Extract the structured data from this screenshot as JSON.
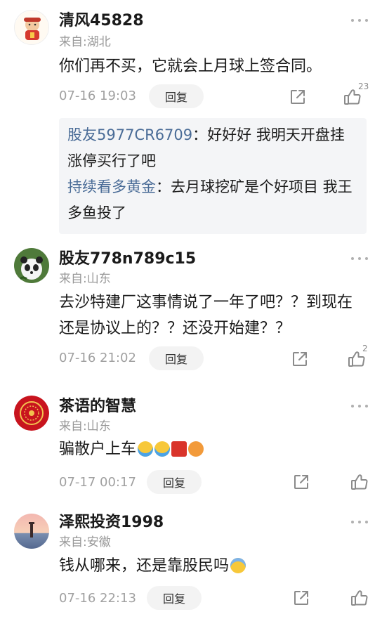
{
  "ui": {
    "reply_label": "回复"
  },
  "comments": [
    {
      "username": "清风45828",
      "location": "来自:湖北",
      "text": "你们再不买，它就会上月球上签合同。",
      "time": "07-16 19:03",
      "likes": "23",
      "replies": [
        {
          "user": "股友5977CR6709",
          "sep": "：",
          "text": "好好好  我明天开盘挂涨停买行了吧"
        },
        {
          "user": "持续看多黄金",
          "sep": "：",
          "text": "去月球挖矿是个好项目  我王多鱼投了"
        }
      ]
    },
    {
      "username": "股友778n789c15",
      "location": "来自:山东",
      "text": "去沙特建厂这事情说了一年了吧？？到现在还是协议上的？？还没开始建？？",
      "time": "07-16 21:02",
      "likes": "2"
    },
    {
      "username": "茶语的智慧",
      "location": "来自:山东",
      "text": "骗散户上车",
      "time": "07-17 00:17",
      "likes": "",
      "emojis": [
        "laughing-crying-emoji",
        "laughing-crying-emoji",
        "red-packet-emoji",
        "angry-face-emoji"
      ]
    },
    {
      "username": "泽熙投资1998",
      "location": "来自:安徽",
      "text": "钱从哪来，还是靠股民吗",
      "time": "07-16 22:13",
      "likes": "",
      "emojis": [
        "shocked-face-emoji"
      ]
    }
  ],
  "colors": {
    "reply_username": "#4a6c97",
    "secondary_text": "#999999",
    "reply_box_bg": "#f4f5f7"
  }
}
